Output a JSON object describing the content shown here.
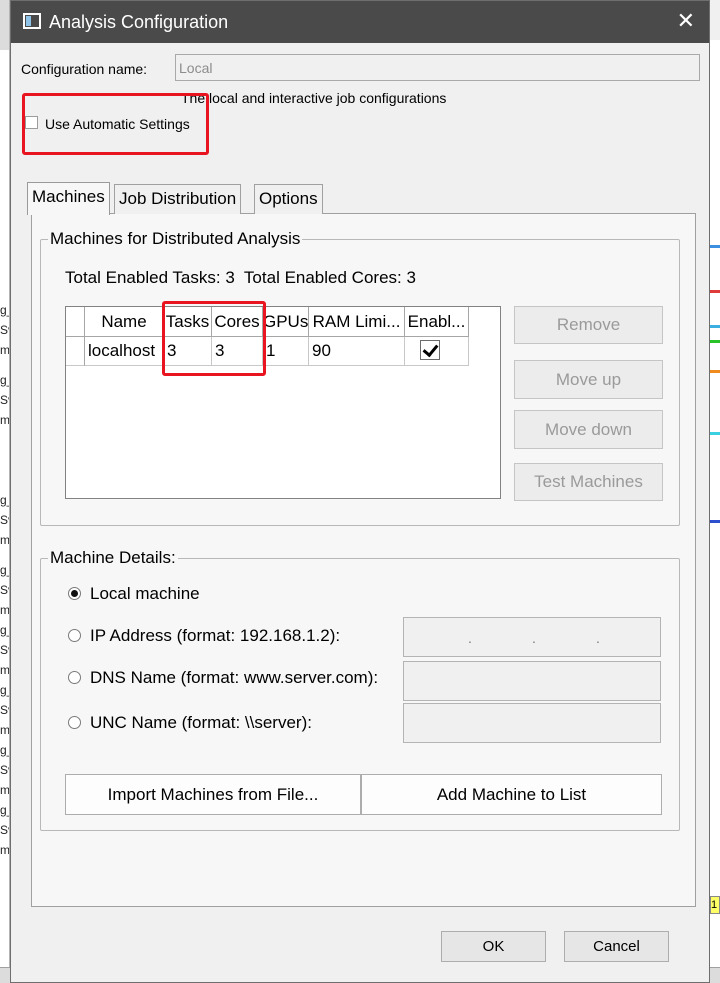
{
  "window": {
    "title": "Analysis Configuration",
    "close_glyph": "✕",
    "icon": "app-window-icon"
  },
  "config": {
    "name_label": "Configuration name:",
    "name_value": "Local",
    "description": "The local and interactive job configurations",
    "auto_settings_label": "Use Automatic Settings",
    "auto_settings_checked": false
  },
  "tabs": [
    {
      "label": "Machines",
      "active": true
    },
    {
      "label": "Job Distribution",
      "active": false
    },
    {
      "label": "Options",
      "active": false
    }
  ],
  "machines_group": {
    "title": "Machines for Distributed Analysis",
    "summary": "Total Enabled Tasks: 3  Total Enabled Cores: 3"
  },
  "table": {
    "columns": [
      "Name",
      "Tasks",
      "Cores",
      "GPUs",
      "RAM Limi...",
      "Enabl..."
    ],
    "rows": [
      {
        "name": "localhost",
        "tasks": "3",
        "cores": "3",
        "gpus": "1",
        "ram": "90",
        "enabled": true
      }
    ]
  },
  "side_buttons": {
    "remove": "Remove",
    "move_up": "Move up",
    "move_down": "Move down",
    "test": "Test Machines"
  },
  "details_group": {
    "title": "Machine Details:",
    "options": [
      {
        "label": "Local machine",
        "checked": true
      },
      {
        "label": "IP Address (format: 192.168.1.2):",
        "checked": false
      },
      {
        "label": "DNS Name (format: www.server.com):",
        "checked": false
      },
      {
        "label": "UNC Name (format: \\\\server):",
        "checked": false
      }
    ],
    "ip_dots": [
      ".",
      ".",
      "."
    ],
    "import_button": "Import Machines from File...",
    "add_button": "Add Machine to List"
  },
  "footer": {
    "ok": "OK",
    "cancel": "Cancel"
  },
  "background": {
    "left_fragments": [
      "g_",
      "Sv",
      "m'"
    ],
    "right_badge": "1"
  },
  "colors": {
    "titlebar": "#4a4a4a",
    "highlight": "#e8141f",
    "disabled_text": "#9a9a9a"
  }
}
